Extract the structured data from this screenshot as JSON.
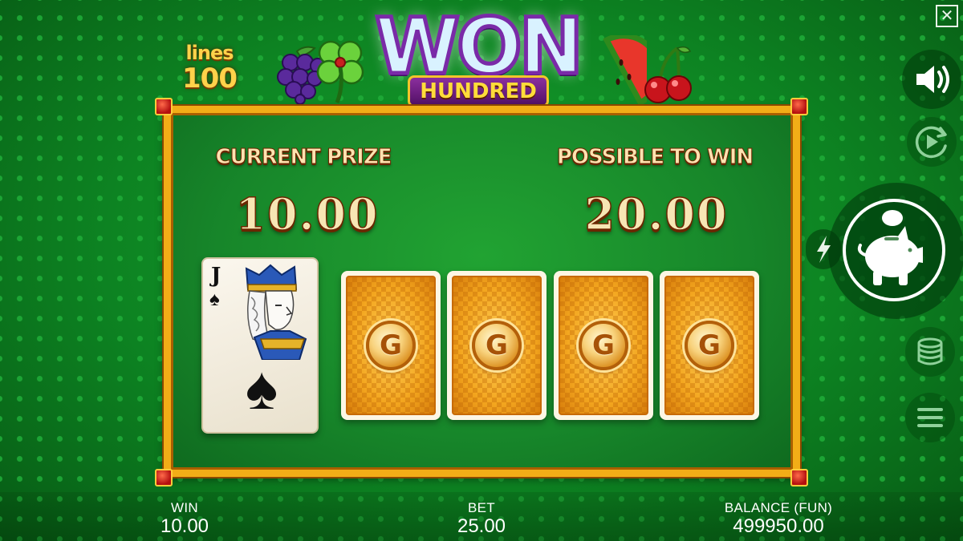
{
  "header": {
    "lines_label": "lines",
    "lines_count": "100",
    "logo_title": "WON",
    "logo_subtitle": "HUNDRED"
  },
  "gamble": {
    "current_prize_label": "CURRENT PRIZE",
    "current_prize_value": "10.00",
    "possible_win_label": "POSSIBLE TO WIN",
    "possible_win_value": "20.00",
    "dealer_card": {
      "rank": "J",
      "suit": "♠"
    },
    "face_down_cards": [
      {
        "emblem": "G"
      },
      {
        "emblem": "G"
      },
      {
        "emblem": "G"
      },
      {
        "emblem": "G"
      }
    ]
  },
  "controls": {
    "close_icon": "close-icon",
    "sound_icon": "speaker-icon",
    "autoplay_icon": "autoplay-icon",
    "turbo_icon": "lightning-icon",
    "spin_icon": "piggy-bank-icon",
    "bet_icon": "coin-stack-icon",
    "menu_icon": "hamburger-menu-icon"
  },
  "footer": {
    "win_label": "WIN",
    "win_value": "10.00",
    "bet_label": "BET",
    "bet_value": "25.00",
    "balance_label": "BALANCE (FUN)",
    "balance_value": "499950.00"
  },
  "colors": {
    "background": "#0c7a1e",
    "board_frame": "#f2ad17",
    "card_back": "#f0a21d",
    "prize_text": "#f7e6b4"
  }
}
